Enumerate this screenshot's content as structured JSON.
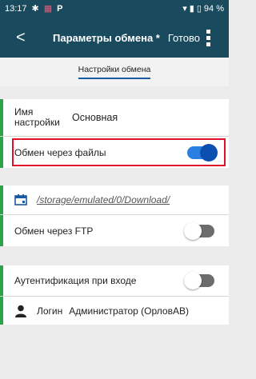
{
  "status_bar": {
    "time": "13:17",
    "icons_left": [
      "settings-icon",
      "media-icon",
      "p-icon"
    ],
    "battery_text": "94 %"
  },
  "app_bar": {
    "back_glyph": "<",
    "title": "Параметры обмена *",
    "done_label": "Готово"
  },
  "tabs": [
    {
      "label": "Настройки обмена",
      "selected": true
    }
  ],
  "settings": {
    "name_label": "Имя настройки",
    "name_value": "Основная",
    "file_exchange_label": "Обмен через файлы",
    "file_exchange_enabled": true,
    "path": "/storage/emulated/0/Download/",
    "ftp_label": "Обмен через FTP",
    "ftp_enabled": false,
    "auth_label": "Аутентификация при входе",
    "auth_enabled": false,
    "login_label": "Логин",
    "login_value": "Администратор (ОрловАВ)"
  },
  "colors": {
    "primary": "#1a4a5e",
    "accent_green": "#2ba34a",
    "toggle_on": "#0b4fb0",
    "highlight_red": "#e0102a"
  }
}
